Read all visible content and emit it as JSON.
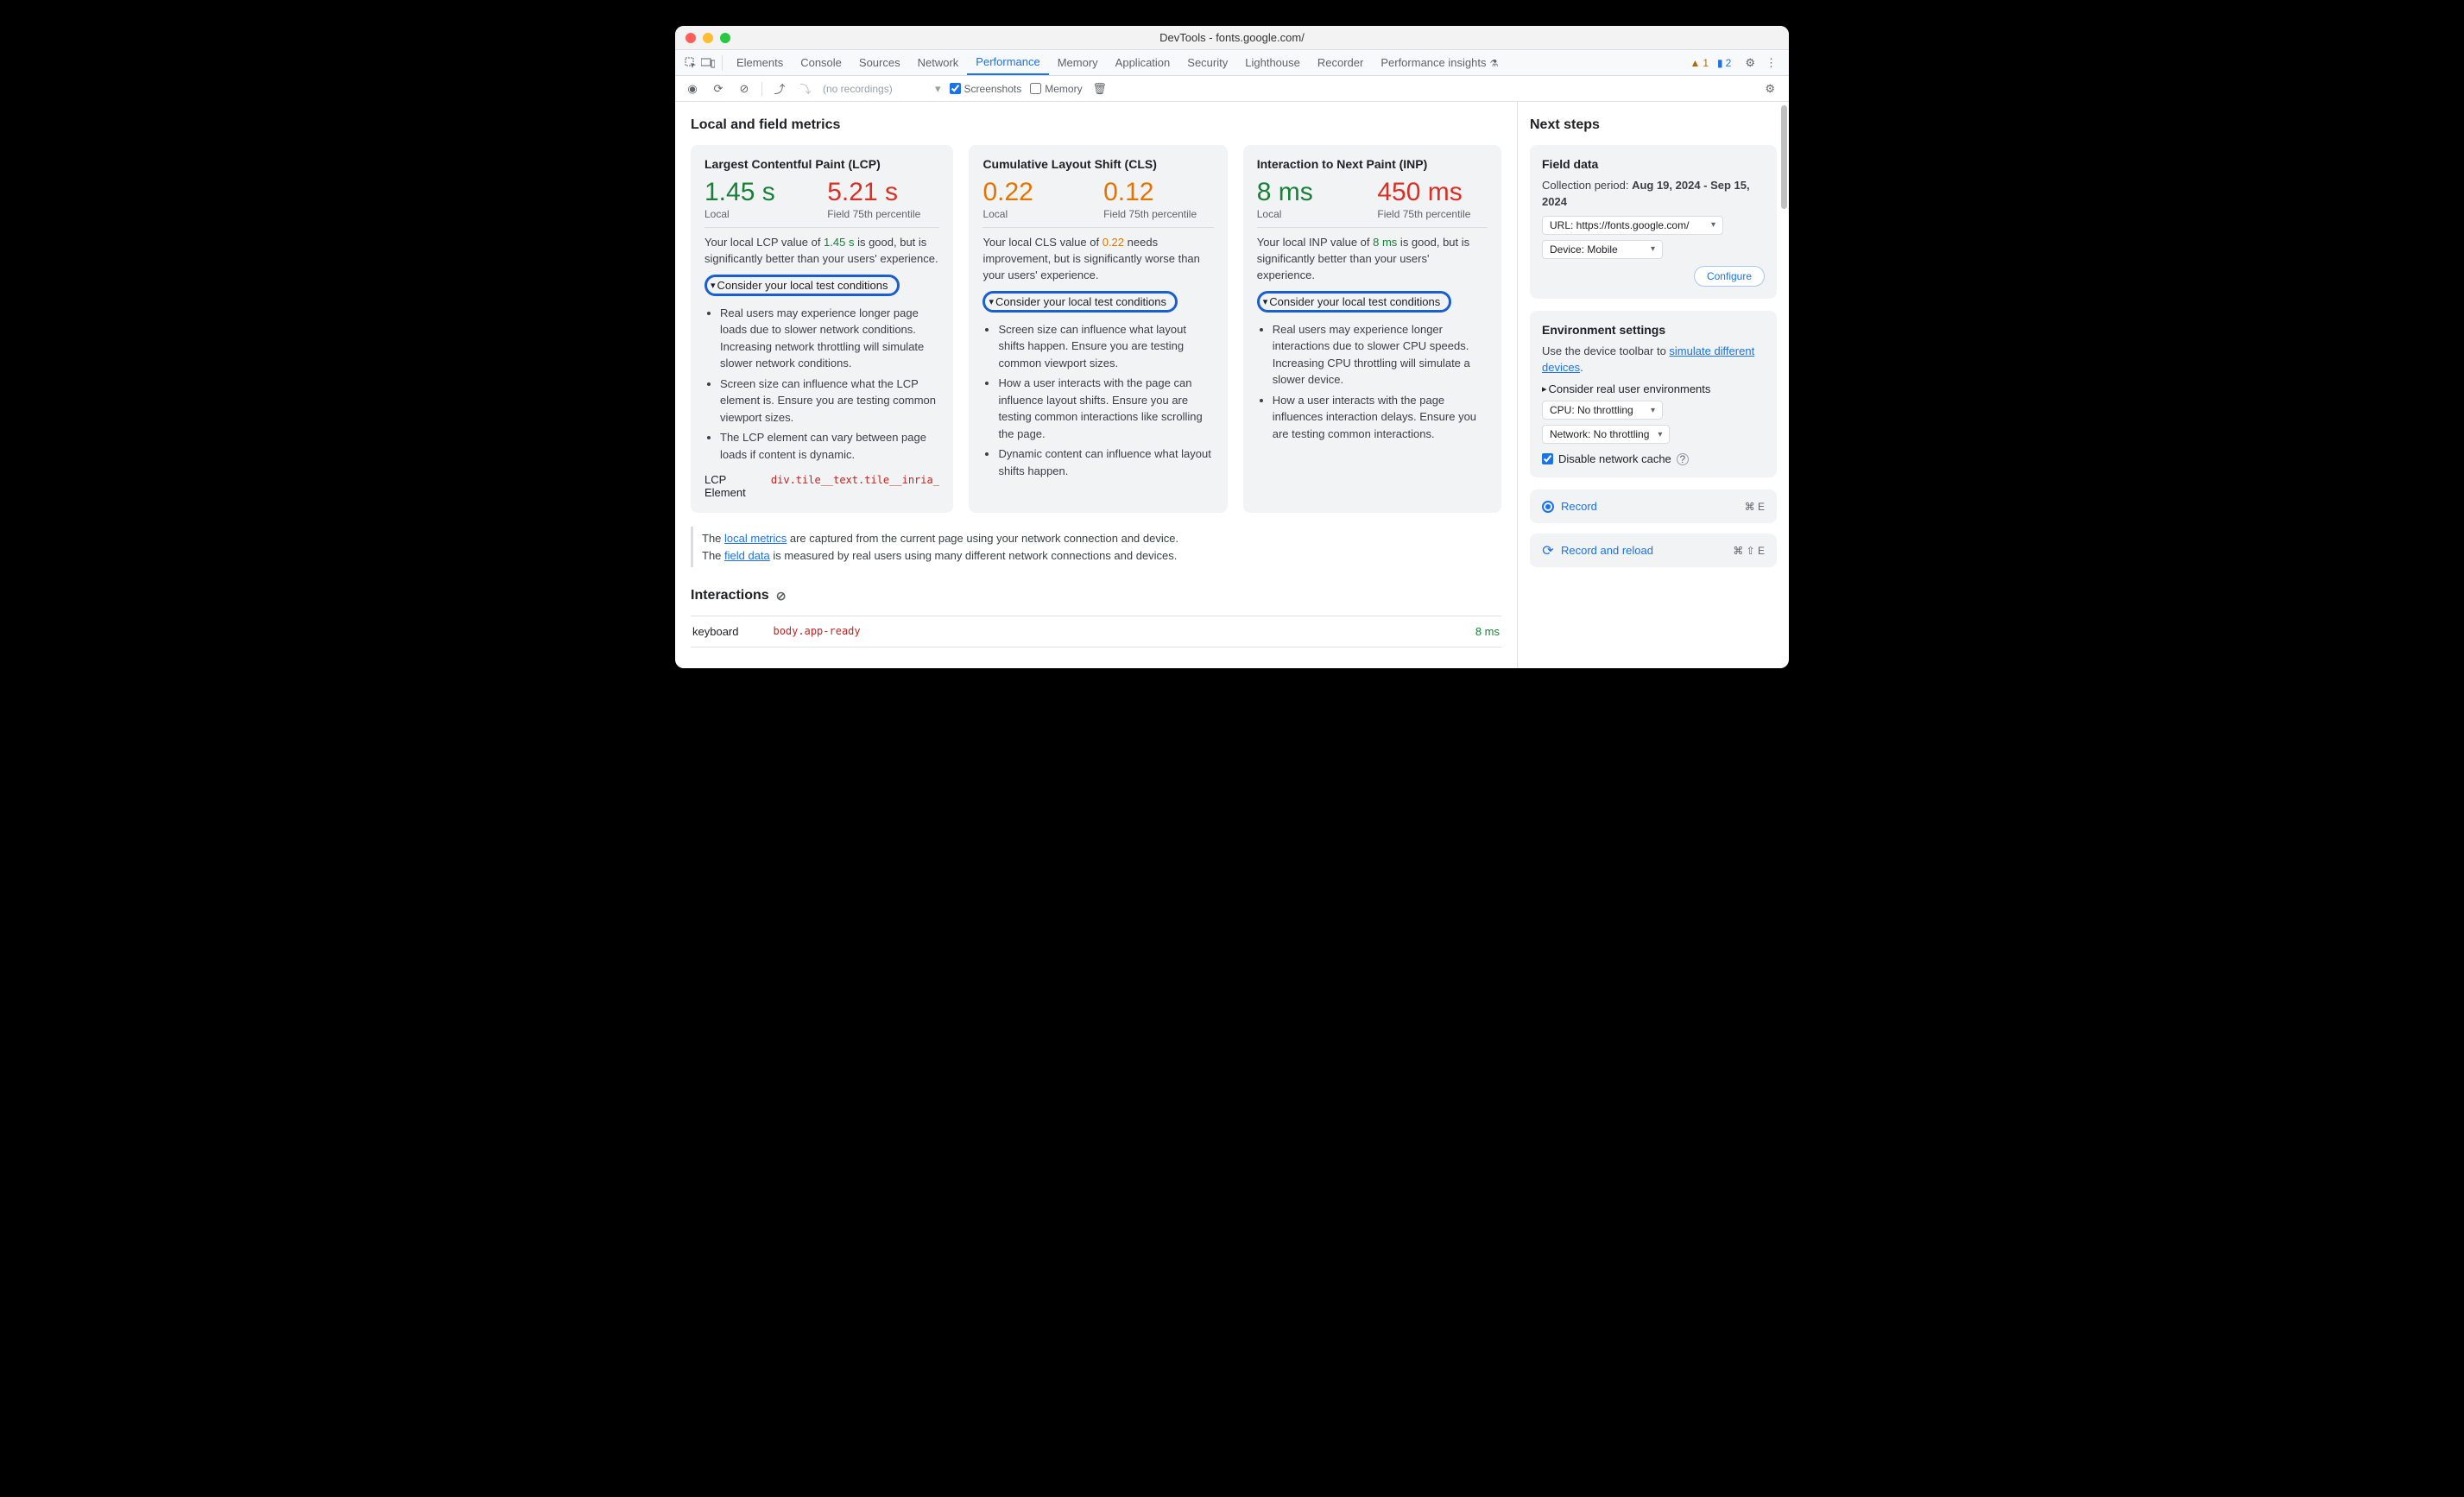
{
  "window_title": "DevTools - fonts.google.com/",
  "tabs": [
    "Elements",
    "Console",
    "Sources",
    "Network",
    "Performance",
    "Memory",
    "Application",
    "Security",
    "Lighthouse",
    "Recorder",
    "Performance insights"
  ],
  "active_tab": "Performance",
  "badge_warn": "1",
  "badge_info": "2",
  "toolbar": {
    "recordings_placeholder": "(no recordings)",
    "screenshots": "Screenshots",
    "memory": "Memory"
  },
  "main_heading": "Local and field metrics",
  "cards": {
    "lcp": {
      "title": "Largest Contentful Paint (LCP)",
      "local_val": "1.45 s",
      "field_val": "5.21 s",
      "local_lbl": "Local",
      "field_lbl": "Field 75th percentile",
      "desc_pre": "Your local LCP value of ",
      "desc_val": "1.45 s",
      "desc_post": " is good, but is significantly better than your users' experience.",
      "disclosure": "Consider your local test conditions",
      "bullets": [
        "Real users may experience longer page loads due to slower network conditions. Increasing network throttling will simulate slower network conditions.",
        "Screen size can influence what the LCP element is. Ensure you are testing common viewport sizes.",
        "The LCP element can vary between page loads if content is dynamic."
      ],
      "lcpel_label": "LCP Element",
      "lcpel_sel": "div.tile__text.tile__inria_san"
    },
    "cls": {
      "title": "Cumulative Layout Shift (CLS)",
      "local_val": "0.22",
      "field_val": "0.12",
      "local_lbl": "Local",
      "field_lbl": "Field 75th percentile",
      "desc_pre": "Your local CLS value of ",
      "desc_val": "0.22",
      "desc_post": " needs improvement, but is significantly worse than your users' experience.",
      "disclosure": "Consider your local test conditions",
      "bullets": [
        "Screen size can influence what layout shifts happen. Ensure you are testing common viewport sizes.",
        "How a user interacts with the page can influence layout shifts. Ensure you are testing common interactions like scrolling the page.",
        "Dynamic content can influence what layout shifts happen."
      ]
    },
    "inp": {
      "title": "Interaction to Next Paint (INP)",
      "local_val": "8 ms",
      "field_val": "450 ms",
      "local_lbl": "Local",
      "field_lbl": "Field 75th percentile",
      "desc_pre": "Your local INP value of ",
      "desc_val": "8 ms",
      "desc_post": " is good, but is significantly better than your users' experience.",
      "disclosure": "Consider your local test conditions",
      "bullets": [
        "Real users may experience longer interactions due to slower CPU speeds. Increasing CPU throttling will simulate a slower device.",
        "How a user interacts with the page influences interaction delays. Ensure you are testing common interactions."
      ]
    }
  },
  "note": {
    "p1a": "The ",
    "p1link": "local metrics",
    "p1b": " are captured from the current page using your network connection and device.",
    "p2a": "The ",
    "p2link": "field data",
    "p2b": " is measured by real users using many different network connections and devices."
  },
  "interactions": {
    "heading": "Interactions",
    "row_type": "keyboard",
    "row_sel": "body.app-ready",
    "row_ms": "8 ms"
  },
  "side": {
    "heading": "Next steps",
    "fielddata": {
      "title": "Field data",
      "period_label": "Collection period: ",
      "period_val": "Aug 19, 2024 - Sep 15, 2024",
      "url_select": "URL: https://fonts.google.com/",
      "device_select": "Device: Mobile",
      "configure": "Configure"
    },
    "env": {
      "title": "Environment settings",
      "txt_pre": "Use the device toolbar to ",
      "txt_link": "simulate different devices",
      "txt_post": ".",
      "disclosure": "Consider real user environments",
      "cpu_select": "CPU: No throttling",
      "net_select": "Network: No throttling",
      "cache_label": "Disable network cache"
    },
    "rec": {
      "label": "Record",
      "short": "⌘ E"
    },
    "recreload": {
      "label": "Record and reload",
      "short": "⌘ ⇧ E"
    }
  }
}
